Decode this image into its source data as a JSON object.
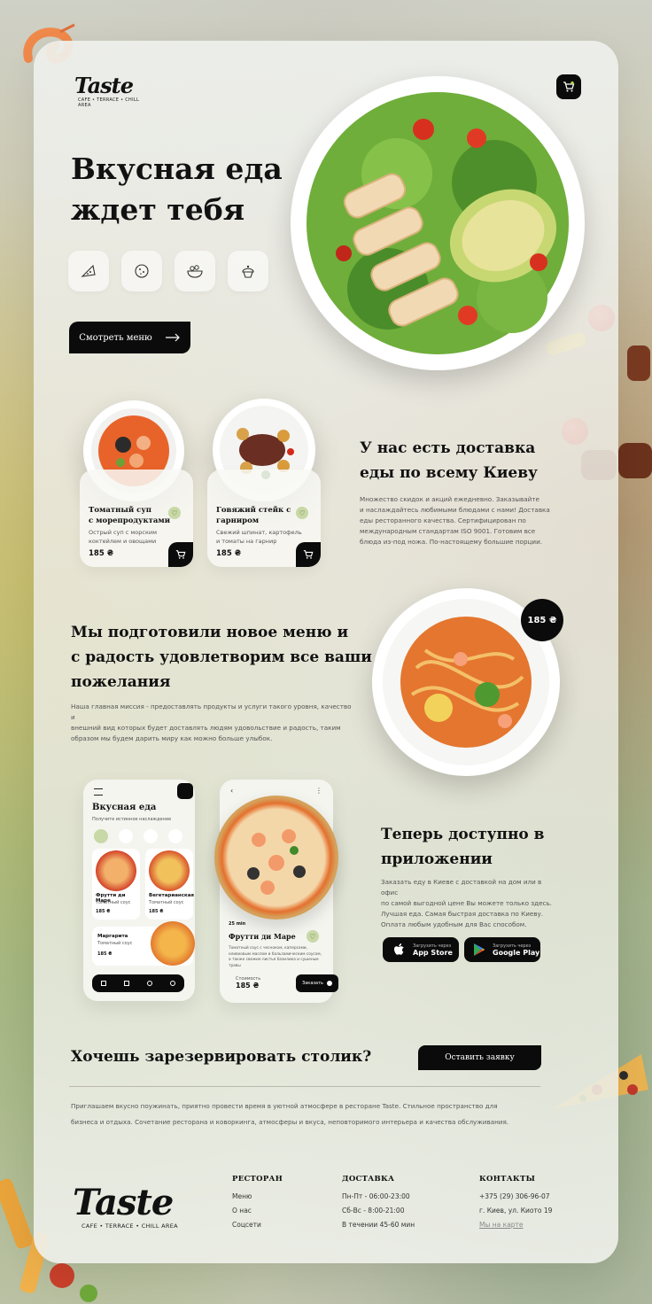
{
  "brand": {
    "name": "Taste",
    "tagline_small": "CAFE • TERRACE • CHILL AREA",
    "tagline_footer": "CAFE • TERRACE • CHILL AREA"
  },
  "hero": {
    "title_line1": "Вкусная еда",
    "title_line2": "ждет тебя",
    "categories": [
      "pizza-icon",
      "cookie-icon",
      "salad-icon",
      "cupcake-icon"
    ],
    "cta": "Смотреть меню"
  },
  "products": [
    {
      "name_l1": "Томатный суп",
      "name_l2": "с морепродуктами",
      "desc_l1": "Острый суп с морским",
      "desc_l2": "коктейлем и овощами",
      "price": "185 ₴"
    },
    {
      "name_l1": "Говяжий стейк с",
      "name_l2": "гарниром",
      "desc_l1": "Свежий шпинат, картофель",
      "desc_l2": "и томаты на гарнир",
      "price": "185 ₴"
    }
  ],
  "delivery": {
    "title_l1": "У нас есть доставка",
    "title_l2": "еды по всему Киеву",
    "text_l1": "Множество скидок и акций ежедневно. Заказывайте",
    "text_l2": "и наслаждайтесь любимыми блюдами с нами! Доставка",
    "text_l3": "еды ресторанного качества. Сертифицирован по",
    "text_l4": "международным стандартам ISO 9001. Готовим все",
    "text_l5": "блюда из-под ножа. По-настоящему большие порции."
  },
  "menu_section": {
    "title_l1": "Мы подготовили новое меню и",
    "title_l2": "с радость удовлетворим все ваши",
    "title_l3": "пожелания",
    "text_l1": "Наша главная миссия - предоставлять продукты и услуги такого уровня, качество и",
    "text_l2": "внешний вид которых будет доставлять людям удовольствие и радость, таким",
    "text_l3": "образом мы будем дарить миру как можно больше улыбок.",
    "price_badge": "185 ₴"
  },
  "app_section": {
    "title_l1": "Теперь доступно в",
    "title_l2": "приложении",
    "text_l1": "Заказать еду в Киеве с доставкой на дом или в офис",
    "text_l2": "по самой выгодной цене Вы можете только здесь.",
    "text_l3": "Лучшая еда. Самая быстрая доставка по Киеву.",
    "text_l4": "Оплата любым удобным для Вас способом.",
    "appstore_small": "Загрузить через",
    "appstore_big": "App Store",
    "gplay_small": "Загрузить через",
    "gplay_big": "Google Play"
  },
  "phone1": {
    "title": "Вкусная еда",
    "subtitle": "Получите истинное наслаждение",
    "item1_name": "Фрутти ди Маре",
    "item1_desc": "Томатный соус",
    "item1_price": "185 ₴",
    "item2_name": "Вегетарианская",
    "item2_desc": "Томатный соус",
    "item2_price": "185 ₴",
    "item3_name": "Маргарита",
    "item3_desc": "Томатный соус",
    "item3_price": "185 ₴"
  },
  "phone2": {
    "time": "25 min",
    "name": "Фрутти ди Маре",
    "desc_l1": "Томатный соус с чесноком, каперсами,",
    "desc_l2": "оливковым маслом и бальзамическим соусом,",
    "desc_l3": "а также свежие листья базилика и сушеные",
    "desc_l4": "травы",
    "price_label": "Стоимость",
    "price": "185 ₴",
    "order": "Заказать"
  },
  "reservation": {
    "title": "Хочешь зарезервировать столик?",
    "button": "Оставить заявку",
    "text_l1": "Приглашаем вкусно поужинать, приятно провести время в уютной атмосфере в ресторане Taste. Стильное пространство для",
    "text_l2": "бизнеса и отдыха. Сочетание ресторана и коворкинга, атмосферы и вкуса, неповторимого интерьера и качества обслуживания."
  },
  "footer": {
    "col1_title": "РЕСТОРАН",
    "col1_items": [
      "Меню",
      "О нас",
      "Соцсети"
    ],
    "col2_title": "ДОСТАВКА",
    "col2_items": [
      "Пн-Пт - 06:00-23:00",
      "Сб-Вс - 8:00-21:00",
      "В течении 45-60 мин"
    ],
    "col3_title": "КОНТАКТЫ",
    "col3_items": [
      "+375 (29) 306-96-07",
      "г. Киев, ул. Киото 19",
      "Мы на карте"
    ]
  },
  "colors": {
    "dark": "#0b0b0b",
    "accent_green": "#c8d8a6"
  }
}
